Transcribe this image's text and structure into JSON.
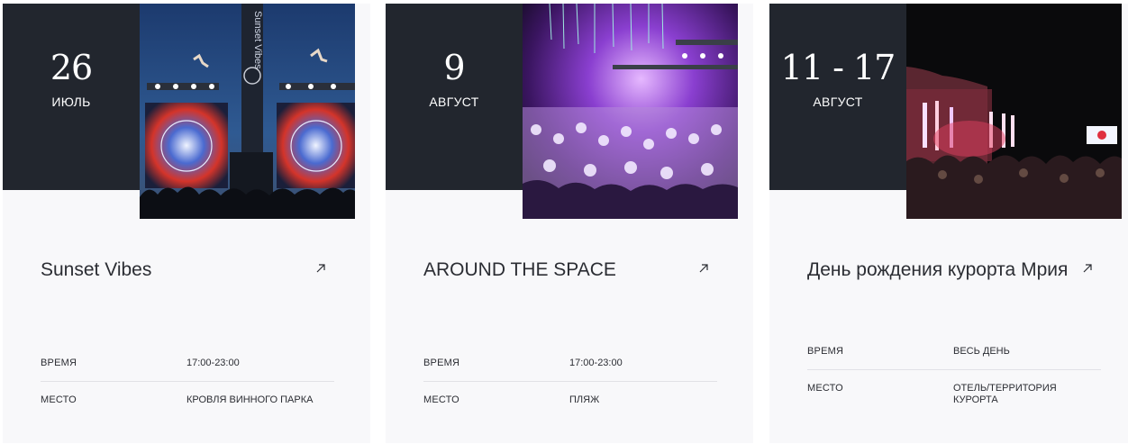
{
  "events": [
    {
      "day": "26",
      "month": "ИЮЛЬ",
      "title": "Sunset Vibes",
      "time_label": "ВРЕМЯ",
      "time_value": "17:00-23:00",
      "place_label": "МЕСТО",
      "place_value": "КРОВЛЯ ВИННОГО ПАРКА",
      "photo_text": "Sunset Vibes"
    },
    {
      "day": "9",
      "month": "АВГУСТ",
      "title": "AROUND THE SPACE",
      "time_label": "ВРЕМЯ",
      "time_value": "17:00-23:00",
      "place_label": "МЕСТО",
      "place_value": "ПЛЯЖ"
    },
    {
      "day": "11 - 17",
      "month": "АВГУСТ",
      "title": "День рождения курорта Мрия",
      "time_label": "ВРЕМЯ",
      "time_value": "ВЕСЬ ДЕНЬ",
      "place_label": "МЕСТО",
      "place_value": "ОТЕЛЬ/ТЕРРИТОРИЯ КУРОРТА"
    }
  ],
  "colors": {
    "date_box": "#22262e",
    "card_bg": "#f8f8fa",
    "text": "#2b2d33"
  },
  "icons": {
    "open": "arrow-up-right-icon"
  }
}
